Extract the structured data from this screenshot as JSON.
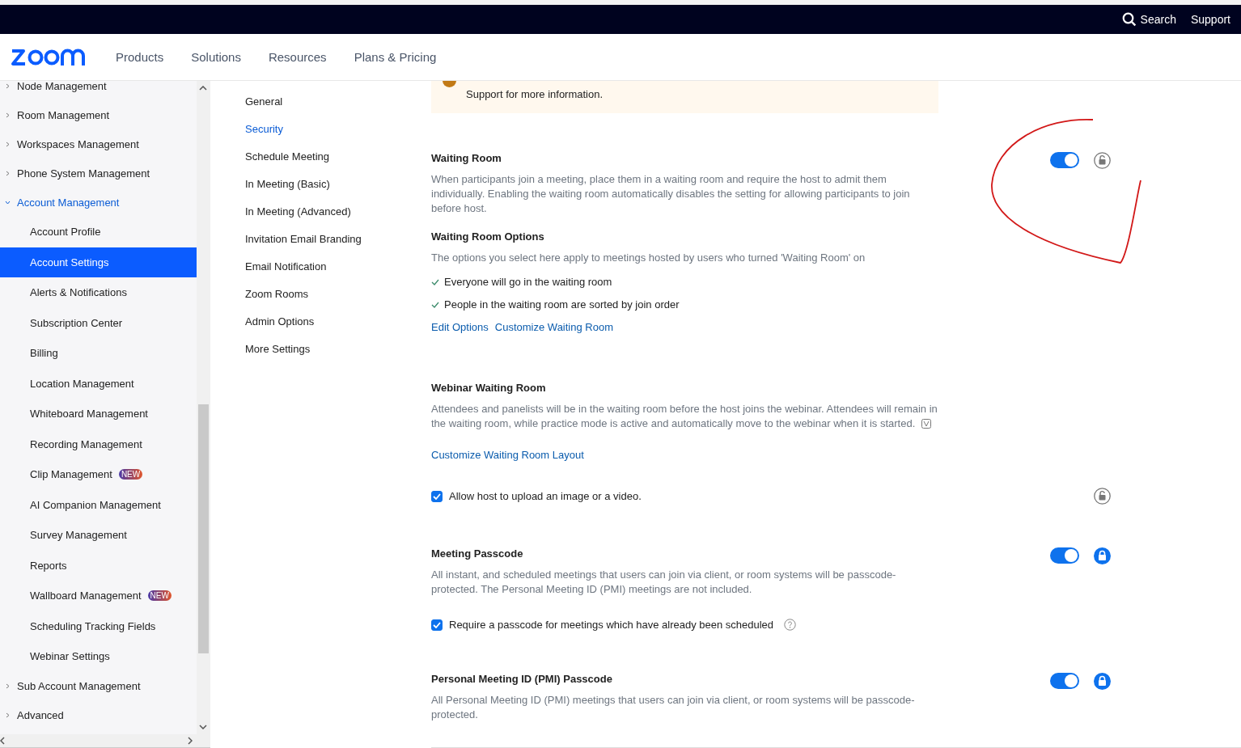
{
  "topbar": {
    "search": "Search",
    "support": "Support"
  },
  "header": {
    "nav": [
      "Products",
      "Solutions",
      "Resources",
      "Plans & Pricing"
    ]
  },
  "sidebar": {
    "items": [
      {
        "label": "Node Management",
        "expanded": false
      },
      {
        "label": "Room Management",
        "expanded": false
      },
      {
        "label": "Workspaces Management",
        "expanded": false
      },
      {
        "label": "Phone System Management",
        "expanded": false
      },
      {
        "label": "Account Management",
        "expanded": true,
        "children": [
          {
            "label": "Account Profile",
            "selected": false
          },
          {
            "label": "Account Settings",
            "selected": true
          },
          {
            "label": "Alerts & Notifications",
            "selected": false
          },
          {
            "label": "Subscription Center",
            "selected": false
          },
          {
            "label": "Billing",
            "selected": false
          },
          {
            "label": "Location Management",
            "selected": false
          },
          {
            "label": "Whiteboard Management",
            "selected": false
          },
          {
            "label": "Recording Management",
            "selected": false
          },
          {
            "label": "Clip Management",
            "selected": false,
            "badge": "NEW"
          },
          {
            "label": "AI Companion Management",
            "selected": false
          },
          {
            "label": "Survey Management",
            "selected": false
          },
          {
            "label": "Reports",
            "selected": false
          },
          {
            "label": "Wallboard Management",
            "selected": false,
            "badge": "NEW"
          },
          {
            "label": "Scheduling Tracking Fields",
            "selected": false
          },
          {
            "label": "Webinar Settings",
            "selected": false
          }
        ]
      },
      {
        "label": "Sub Account Management",
        "expanded": false
      },
      {
        "label": "Advanced",
        "expanded": false
      }
    ]
  },
  "subnav": [
    {
      "label": "General",
      "selected": false
    },
    {
      "label": "Security",
      "selected": true
    },
    {
      "label": "Schedule Meeting",
      "selected": false
    },
    {
      "label": "In Meeting (Basic)",
      "selected": false
    },
    {
      "label": "In Meeting (Advanced)",
      "selected": false
    },
    {
      "label": "Invitation Email Branding",
      "selected": false
    },
    {
      "label": "Email Notification",
      "selected": false
    },
    {
      "label": "Zoom Rooms",
      "selected": false
    },
    {
      "label": "Admin Options",
      "selected": false
    },
    {
      "label": "More Settings",
      "selected": false
    }
  ],
  "banner": {
    "text": "Support for more information."
  },
  "sections": [
    {
      "title": "Waiting Room",
      "toggle": {
        "on": true
      },
      "locked": false,
      "description": "When participants join a meeting, place them in a waiting room and require the host to admit them individually. Enabling the waiting room automatically disables the setting for allowing participants to join before host.",
      "options": {
        "title": "Waiting Room Options",
        "description": "The options you select here apply to meetings hosted by users who turned 'Waiting Room' on",
        "checks": [
          "Everyone will go in the waiting room",
          "People in the waiting room are sorted by join order"
        ],
        "links": [
          "Edit Options",
          "Customize Waiting Room"
        ]
      }
    },
    {
      "title": "Webinar Waiting Room",
      "description": "Attendees and panelists will be in the waiting room before the host joins the webinar. Attendees will remain in the waiting room, while practice mode is active and automatically move to the webinar when it is started.",
      "note_icon": true,
      "links": [
        "Customize Waiting Room Layout"
      ],
      "checkbox": {
        "label": "Allow host to upload an image or a video.",
        "checked": true,
        "locked": false
      }
    },
    {
      "title": "Meeting Passcode",
      "toggle": {
        "on": true
      },
      "locked": true,
      "description": "All instant, and scheduled meetings that users can join via client, or room systems will be passcode-protected. The Personal Meeting ID (PMI) meetings are not included.",
      "checkbox": {
        "label": "Require a passcode for meetings which have already been scheduled",
        "checked": true,
        "help": true
      }
    },
    {
      "title": "Personal Meeting ID (PMI) Passcode",
      "toggle": {
        "on": true
      },
      "locked": true,
      "description": "All Personal Meeting ID (PMI) meetings that users can join via client, or room systems will be passcode-protected."
    }
  ]
}
